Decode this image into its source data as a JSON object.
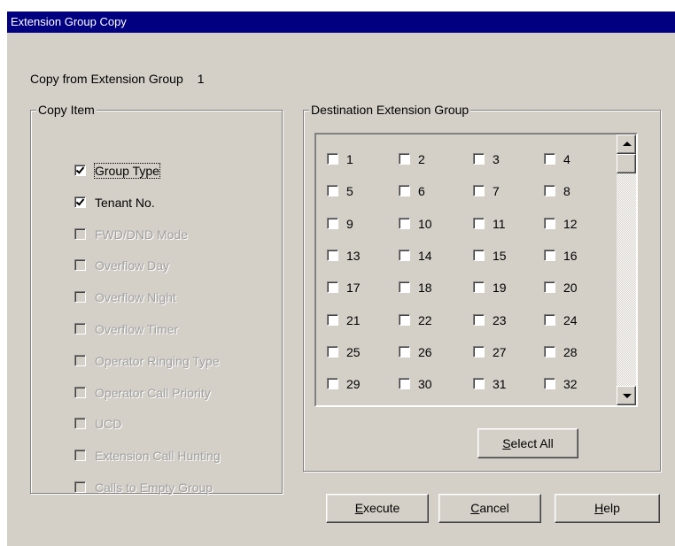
{
  "window": {
    "title": "Extension Group Copy"
  },
  "copy_from": {
    "label": "Copy from Extension Group",
    "value": "1"
  },
  "copy_item": {
    "legend": "Copy Item",
    "items": [
      {
        "label": "Group Type",
        "checked": true,
        "enabled": true
      },
      {
        "label": "Tenant No.",
        "checked": true,
        "enabled": true
      },
      {
        "label": "FWD/DND Mode",
        "checked": false,
        "enabled": false
      },
      {
        "label": "Overflow Day",
        "checked": false,
        "enabled": false
      },
      {
        "label": "Overflow Night",
        "checked": false,
        "enabled": false
      },
      {
        "label": "Overflow Timer",
        "checked": false,
        "enabled": false
      },
      {
        "label": "Operator Ringing Type",
        "checked": false,
        "enabled": false
      },
      {
        "label": "Operator Call Priority",
        "checked": false,
        "enabled": false
      },
      {
        "label": "UCD",
        "checked": false,
        "enabled": false
      },
      {
        "label": "Extension Call Hunting",
        "checked": false,
        "enabled": false
      },
      {
        "label": "Calls to Empty Group",
        "checked": false,
        "enabled": false
      }
    ]
  },
  "destination": {
    "legend": "Destination Extension Group",
    "groups": [
      "1",
      "2",
      "3",
      "4",
      "5",
      "6",
      "7",
      "8",
      "9",
      "10",
      "11",
      "12",
      "13",
      "14",
      "15",
      "16",
      "17",
      "18",
      "19",
      "20",
      "21",
      "22",
      "23",
      "24",
      "25",
      "26",
      "27",
      "28",
      "29",
      "30",
      "31",
      "32"
    ],
    "select_all": {
      "mnemonic": "S",
      "rest": "elect All"
    }
  },
  "buttons": {
    "execute": {
      "mnemonic": "E",
      "rest": "xecute"
    },
    "cancel": {
      "mnemonic": "C",
      "rest": "ancel"
    },
    "help": {
      "mnemonic": "H",
      "rest": "elp"
    }
  }
}
